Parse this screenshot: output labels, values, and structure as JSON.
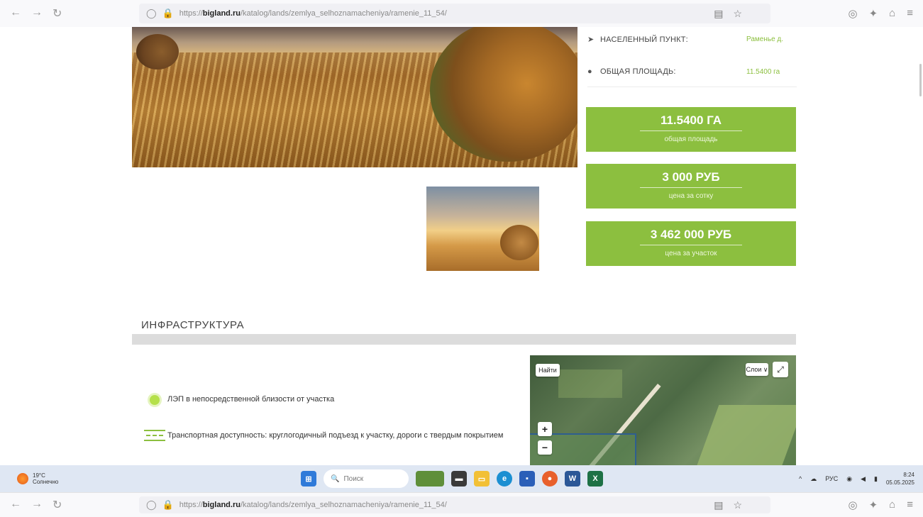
{
  "browser": {
    "url": "https://biglandru/katalog/lands/zemlya_selhoznamacheniya/ramenie_11_54/",
    "url_domain": "bigland.ru",
    "url_path": "/katalog/lands/zemlya_selhoznamacheniya/ramenie_11_54/",
    "url_prefix": "https://"
  },
  "details": {
    "locality_label": "НАСЕЛЕННЫЙ ПУНКТ:",
    "locality_value": "Раменье д.",
    "area_label": "ОБЩАЯ ПЛОЩАДЬ:",
    "area_value": "11.5400 га"
  },
  "price_boxes": [
    {
      "value": "11.5400 ГА",
      "caption": "общая площадь"
    },
    {
      "value": "3 000 РУБ",
      "caption": "цена за сотку"
    },
    {
      "value": "3 462 000 РУБ",
      "caption": "цена за участок"
    }
  ],
  "infrastructure": {
    "title": "ИНФРАСТРУКТУРА",
    "items": [
      {
        "text": "ЛЭП в непосредственной близости от участка",
        "icon": "lightbulb-icon"
      },
      {
        "text": "Транспортная доступность: круглогодичный подъезд к участку, дороги с твердым покрытием",
        "icon": "road-icon"
      }
    ]
  },
  "map": {
    "find_label": "Найти",
    "layers_label": "Слои ∨",
    "zoom_in": "+",
    "zoom_out": "−"
  },
  "taskbar": {
    "weather_temp": "19°C",
    "weather_text": "Солнечно",
    "search_placeholder": "Поиск",
    "lang": "РУС",
    "time": "8:24",
    "date": "05.05.2025"
  },
  "colors": {
    "accent_green": "#8cbf3f"
  }
}
